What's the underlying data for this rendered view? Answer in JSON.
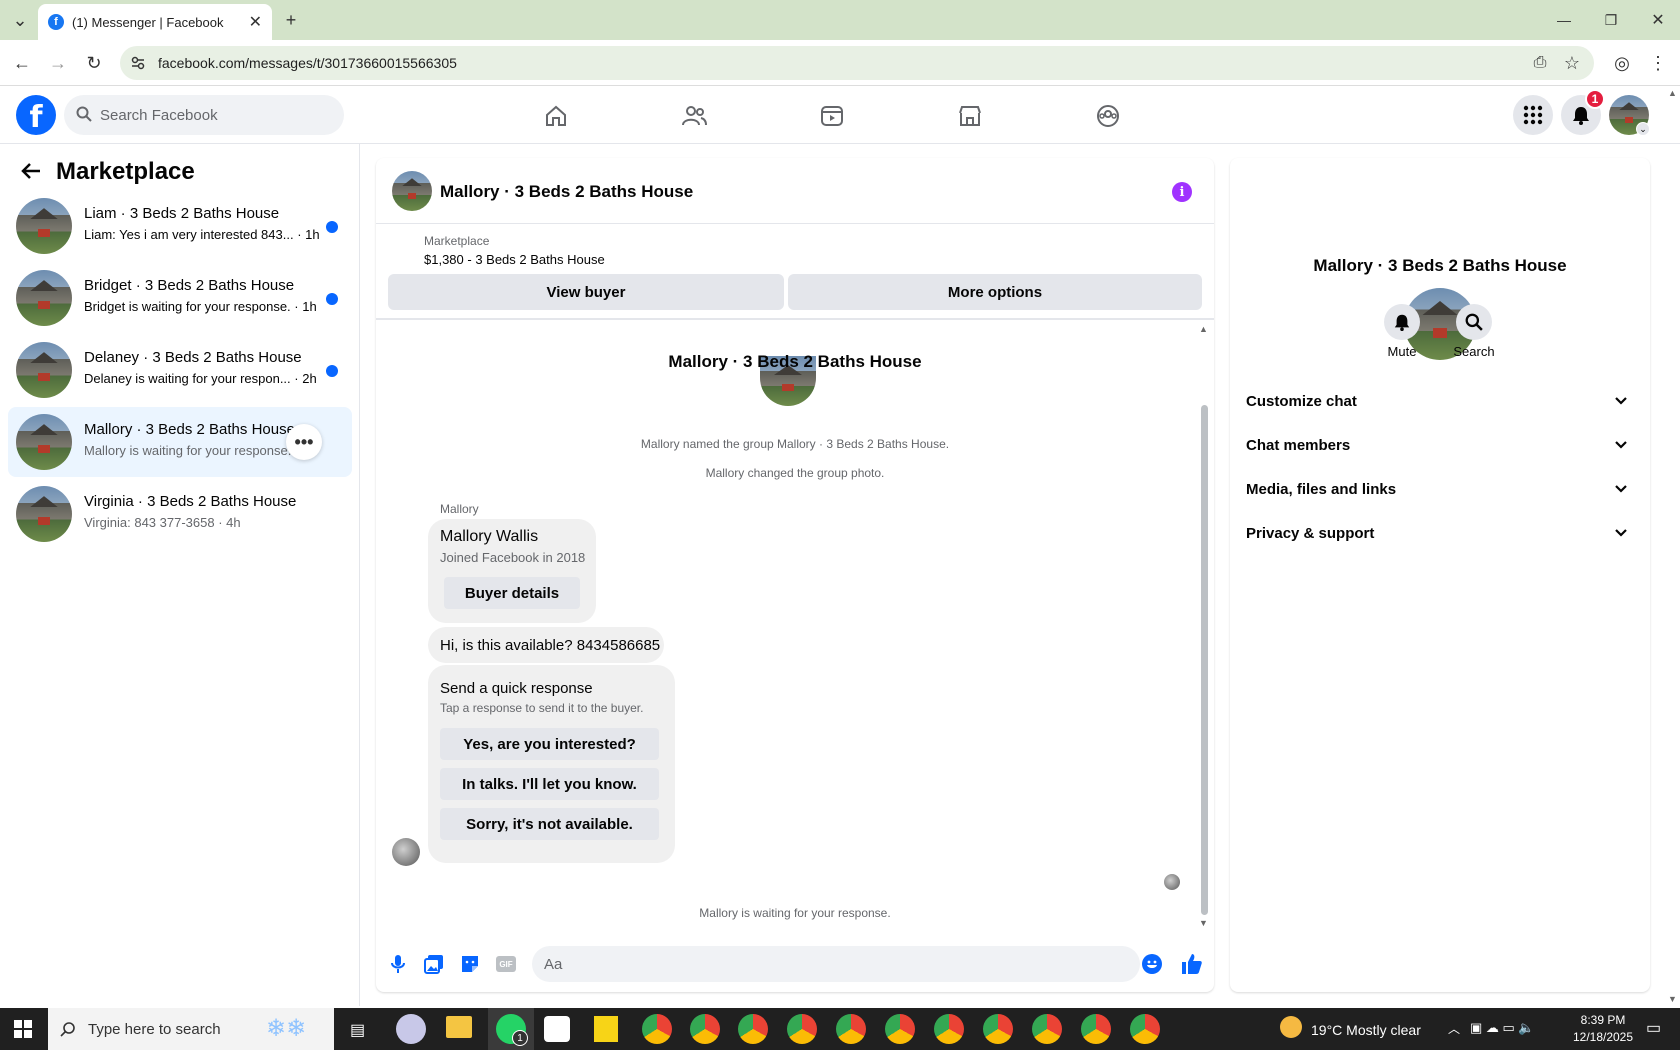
{
  "browser": {
    "tab_title": "(1) Messenger | Facebook",
    "url": "facebook.com/messages/t/30173660015566305"
  },
  "fb": {
    "search_placeholder": "Search Facebook",
    "notification_count": "1"
  },
  "left": {
    "title": "Marketplace",
    "conversations": [
      {
        "name": "Liam · 3 Beds 2 Baths House",
        "preview": "Liam: Yes i am very interested 843...",
        "time": "· 1h",
        "unread": true
      },
      {
        "name": "Bridget · 3 Beds 2 Baths House",
        "preview": "Bridget is waiting for your response.",
        "time": "· 1h",
        "unread": true
      },
      {
        "name": "Delaney · 3 Beds 2 Baths House",
        "preview": "Delaney is waiting for your respon...",
        "time": "· 2h",
        "unread": true
      },
      {
        "name": "Mallory · 3 Beds 2 Baths House",
        "preview": "Mallory is waiting for your response.",
        "time": "",
        "unread": false
      },
      {
        "name": "Virginia · 3 Beds 2 Baths House",
        "preview": "Virginia: 843 377-3658",
        "time": "· 4h",
        "unread": false
      }
    ]
  },
  "chat": {
    "title": "Mallory · 3 Beds 2 Baths House",
    "marketplace_label": "Marketplace",
    "listing": "$1,380 - 3 Beds 2 Baths House",
    "view_buyer": "View buyer",
    "more_options": "More options",
    "center_title": "Mallory · 3 Beds 2 Baths House",
    "sys1": "Mallory named the group Mallory · 3 Beds 2 Baths House.",
    "sys2": "Mallory changed the group photo.",
    "sender": "Mallory",
    "card_name": "Mallory Wallis",
    "card_sub": "Joined Facebook in 2018",
    "buyer_details": "Buyer details",
    "message": "Hi, is this available? 8434586685",
    "quick_title": "Send a quick response",
    "quick_sub": "Tap a response to send it to the buyer.",
    "quick1": "Yes, are you interested?",
    "quick2": "In talks. I'll let you know.",
    "quick3": "Sorry, it's not available.",
    "waiting": "Mallory is waiting for your response.",
    "composer_placeholder": "Aa"
  },
  "right": {
    "title": "Mallory · 3 Beds 2 Baths House",
    "mute": "Mute",
    "search": "Search",
    "rows": [
      "Customize chat",
      "Chat members",
      "Media, files and links",
      "Privacy & support"
    ]
  },
  "taskbar": {
    "search_placeholder": "Type here to search",
    "weather": "19°C  Mostly clear",
    "time": "8:39 PM",
    "date": "12/18/2025",
    "whatsapp_badge": "1"
  },
  "colors": {
    "fb_blue": "#0866ff",
    "accent_purple": "#a033ff",
    "unread_dot": "#0866ff"
  }
}
